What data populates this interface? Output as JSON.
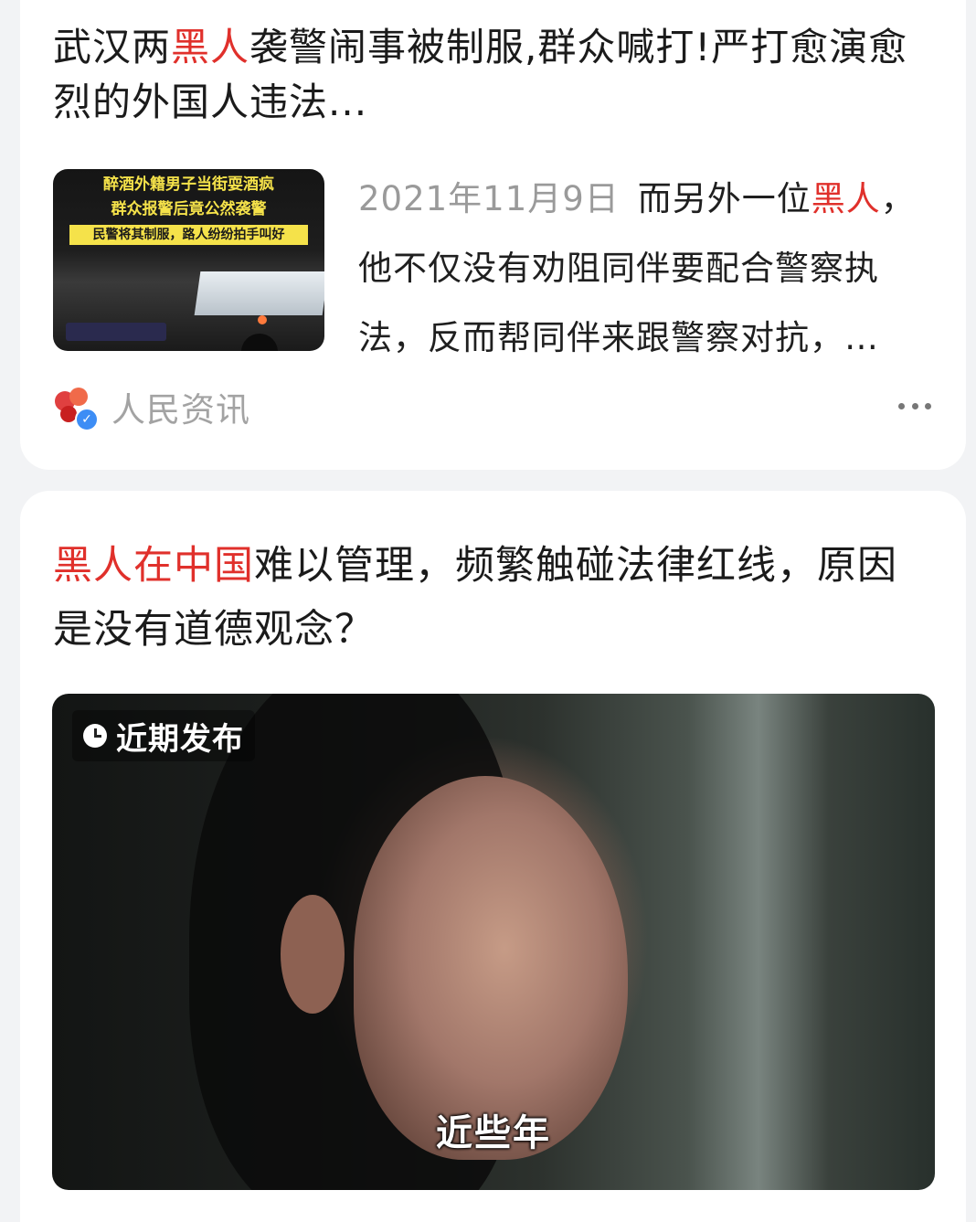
{
  "feed": {
    "items": [
      {
        "title_pre": "武汉两",
        "title_hl": "黑人",
        "title_post": "袭警闹事被制服,群众喊打!严打愈演愈烈的外国人违法...",
        "thumbnail": {
          "caption_line1": "醉酒外籍男子当街耍酒疯",
          "caption_line2": "群众报警后竟公然袭警",
          "caption_line3": "民警将其制服，路人纷纷拍手叫好"
        },
        "date": "2021年11月9日",
        "summary_pre": "而另外一位",
        "summary_hl": "黑人",
        "summary_post": "，他不仅没有劝阻同伴要配合警察执法，反而帮同伴来跟警察对抗，…",
        "source_name": "人民资讯",
        "source_logo_icon": "renmin-logo-icon",
        "verified_icon": "verified-badge-icon",
        "more_icon": "more-dots-icon"
      },
      {
        "title_hl": "黑人在中国",
        "title_post": "难以管理，频繁触碰法律红线，原因是没有道德观念？",
        "video": {
          "badge_text": "近期发布",
          "badge_icon": "clock-icon",
          "subtitle": "近些年"
        }
      }
    ]
  },
  "colors": {
    "highlight": "#e0302b",
    "page_bg": "#f2f3f5",
    "card_bg": "#ffffff",
    "muted_text": "#9a9a9a"
  }
}
